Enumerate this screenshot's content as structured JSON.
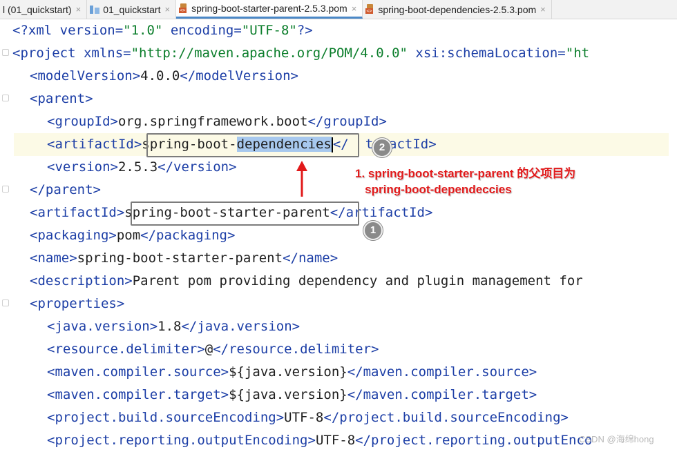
{
  "tabs": [
    {
      "label": "l (01_quickstart)",
      "icon": "none",
      "active": false
    },
    {
      "label": "01_quickstart",
      "icon": "module-icon",
      "active": false
    },
    {
      "label": "spring-boot-starter-parent-2.5.3.pom",
      "icon": "maven-pom-icon",
      "active": true
    },
    {
      "label": "spring-boot-dependencies-2.5.3.pom",
      "icon": "maven-pom-icon",
      "active": false
    }
  ],
  "tab_close_glyph": "×",
  "code": {
    "l1": {
      "a": "<?xml ",
      "b": "version=",
      "c": "\"1.0\"",
      "d": " ",
      "e": "encoding=",
      "f": "\"UTF-8\"",
      "g": "?>"
    },
    "l2": {
      "a": "<project ",
      "b": "xmlns=",
      "c": "\"http://maven.apache.org/POM/4.0.0\"",
      "d": " xsi:schemaLocation=",
      "e": "\"ht"
    },
    "l3": {
      "open": "<modelVersion>",
      "text": "4.0.0",
      "close": "</modelVersion>"
    },
    "l4": {
      "open": "<parent>"
    },
    "l5": {
      "open": "<groupId>",
      "text": "org.springframework.boot",
      "close": "</groupId>"
    },
    "l6": {
      "open": "<artifactId>",
      "text_a": "spring-boot-",
      "text_sel": "dependencies",
      "close_a": "</",
      "close_b": "tifactId>"
    },
    "l7": {
      "open": "<version>",
      "text": "2.5.3",
      "close": "</version>"
    },
    "l8": {
      "close": "</parent>"
    },
    "l9": {
      "open": "<artifactId>",
      "text": "spring-boot-starter-parent",
      "close": "</artifactId>"
    },
    "l10": {
      "open": "<packaging>",
      "text": "pom",
      "close": "</packaging>"
    },
    "l11": {
      "open": "<name>",
      "text": "spring-boot-starter-parent",
      "close": "</name>"
    },
    "l12": {
      "open": "<description>",
      "text": "Parent pom providing dependency and plugin management for"
    },
    "l13": {
      "open": "<properties>"
    },
    "l14": {
      "open": "<java.version>",
      "text": "1.8",
      "close": "</java.version>"
    },
    "l15": {
      "open": "<resource.delimiter>",
      "text": "@",
      "close": "</resource.delimiter>"
    },
    "l16": {
      "open": "<maven.compiler.source>",
      "text": "${java.version}",
      "close": "</maven.compiler.source>"
    },
    "l17": {
      "open": "<maven.compiler.target>",
      "text": "${java.version}",
      "close": "</maven.compiler.target>"
    },
    "l18": {
      "open": "<project.build.sourceEncoding>",
      "text": "UTF-8",
      "close": "</project.build.sourceEncoding>"
    },
    "l19": {
      "open": "<project.reporting.outputEncoding>",
      "text": "UTF-8",
      "close": "</project.reporting.outputEnco"
    }
  },
  "annotation": {
    "badge_1": "1",
    "badge_2": "2",
    "note_line1": "1. spring-boot-starter-parent 的父项目为",
    "note_line2": "   spring-boot-dependeccies"
  },
  "colors": {
    "tag": "#1c3ea6",
    "string": "#0a7d2a",
    "annotation": "#e1191a",
    "selection": "#a7c8ee",
    "current_line": "#fcfae6"
  },
  "watermark": "CSDN @海绵hong"
}
